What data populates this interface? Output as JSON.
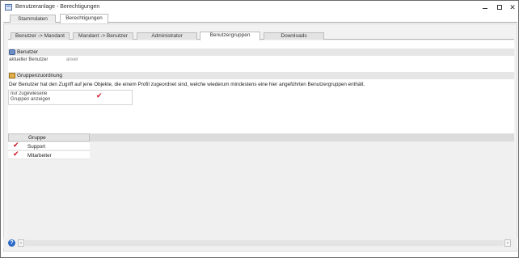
{
  "window": {
    "title": "Benutzeranlage - Berechtigungen"
  },
  "top_tabs": [
    {
      "label": "Stammdaten",
      "active": false
    },
    {
      "label": "Berechtigungen",
      "active": true
    }
  ],
  "sub_tabs": [
    {
      "label": "Benutzer -> Mandant",
      "active": false
    },
    {
      "label": "Mandant -> Benutzer",
      "active": false
    },
    {
      "label": "Administrator",
      "active": false
    },
    {
      "label": "Benutzergruppen",
      "active": true
    },
    {
      "label": "Downloads",
      "active": false
    }
  ],
  "benutzer_section": {
    "title": "Benutzer",
    "icon": "user-icon",
    "current_user_label": "aktueller Benutzer",
    "current_user_value": "anver"
  },
  "gruppen_section": {
    "title": "Gruppenzuordnung",
    "icon": "group-icon",
    "description": "Der Benutzer hat den Zugriff auf jene Objekte, die einem Profil zugeordnet sind, welche wiederum mindestens eine hier angeführten Benutzergruppen enthält.",
    "checkbox_label": "nur zugewiesene Gruppen anzeigen",
    "checkbox_checked": true
  },
  "group_table": {
    "column_header": "Gruppe",
    "rows": [
      {
        "name": "Support",
        "checked": true
      },
      {
        "name": "Mitarbeiter",
        "checked": true
      }
    ]
  },
  "status_bar": {
    "help_glyph": "?",
    "scroll_left_glyph": "‹",
    "scroll_right_glyph": "›"
  },
  "window_buttons": {
    "close_glyph": "✕"
  },
  "check_glyph": "✔",
  "colors": {
    "checkmark": "#cc1122",
    "help": "#2a6ac8"
  }
}
